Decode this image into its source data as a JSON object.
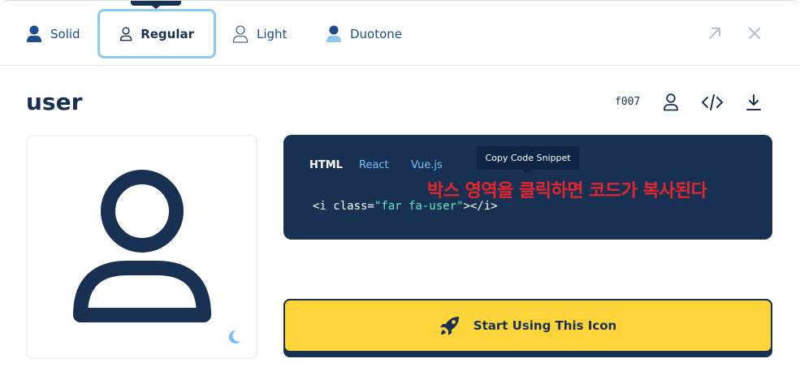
{
  "tabs": {
    "items": [
      {
        "label": "Solid",
        "icon": "user-solid-icon"
      },
      {
        "label": "Regular",
        "icon": "user-regular-icon",
        "active": true
      },
      {
        "label": "Light",
        "icon": "user-light-icon"
      },
      {
        "label": "Duotone",
        "icon": "user-duotone-icon"
      }
    ]
  },
  "window": {
    "expand_icon": "arrow-up-right-icon",
    "close_icon": "close-icon"
  },
  "icon_detail": {
    "name": "user",
    "unicode": "f007",
    "actions": [
      "user-glyph-icon",
      "code-icon",
      "download-icon"
    ]
  },
  "preview": {
    "theme_toggle_icon": "moon-icon"
  },
  "code": {
    "tabs": [
      {
        "label": "HTML",
        "active": true
      },
      {
        "label": "React"
      },
      {
        "label": "Vue.js"
      }
    ],
    "snippet_prefix": "<i class=",
    "snippet_string": "\"far fa-user\"",
    "snippet_suffix": "></i>",
    "tooltip": "Copy Code Snippet"
  },
  "annotation": "박스 영역을 클릭하면 코드가 복사된다",
  "cta": {
    "label": "Start Using This Icon",
    "icon": "rocket-icon"
  },
  "colors": {
    "navy": "#183153",
    "accent_blue": "#74c0fc",
    "yellow": "#ffd43b",
    "annotation_red": "#e5262c",
    "code_string": "#63e6be"
  }
}
